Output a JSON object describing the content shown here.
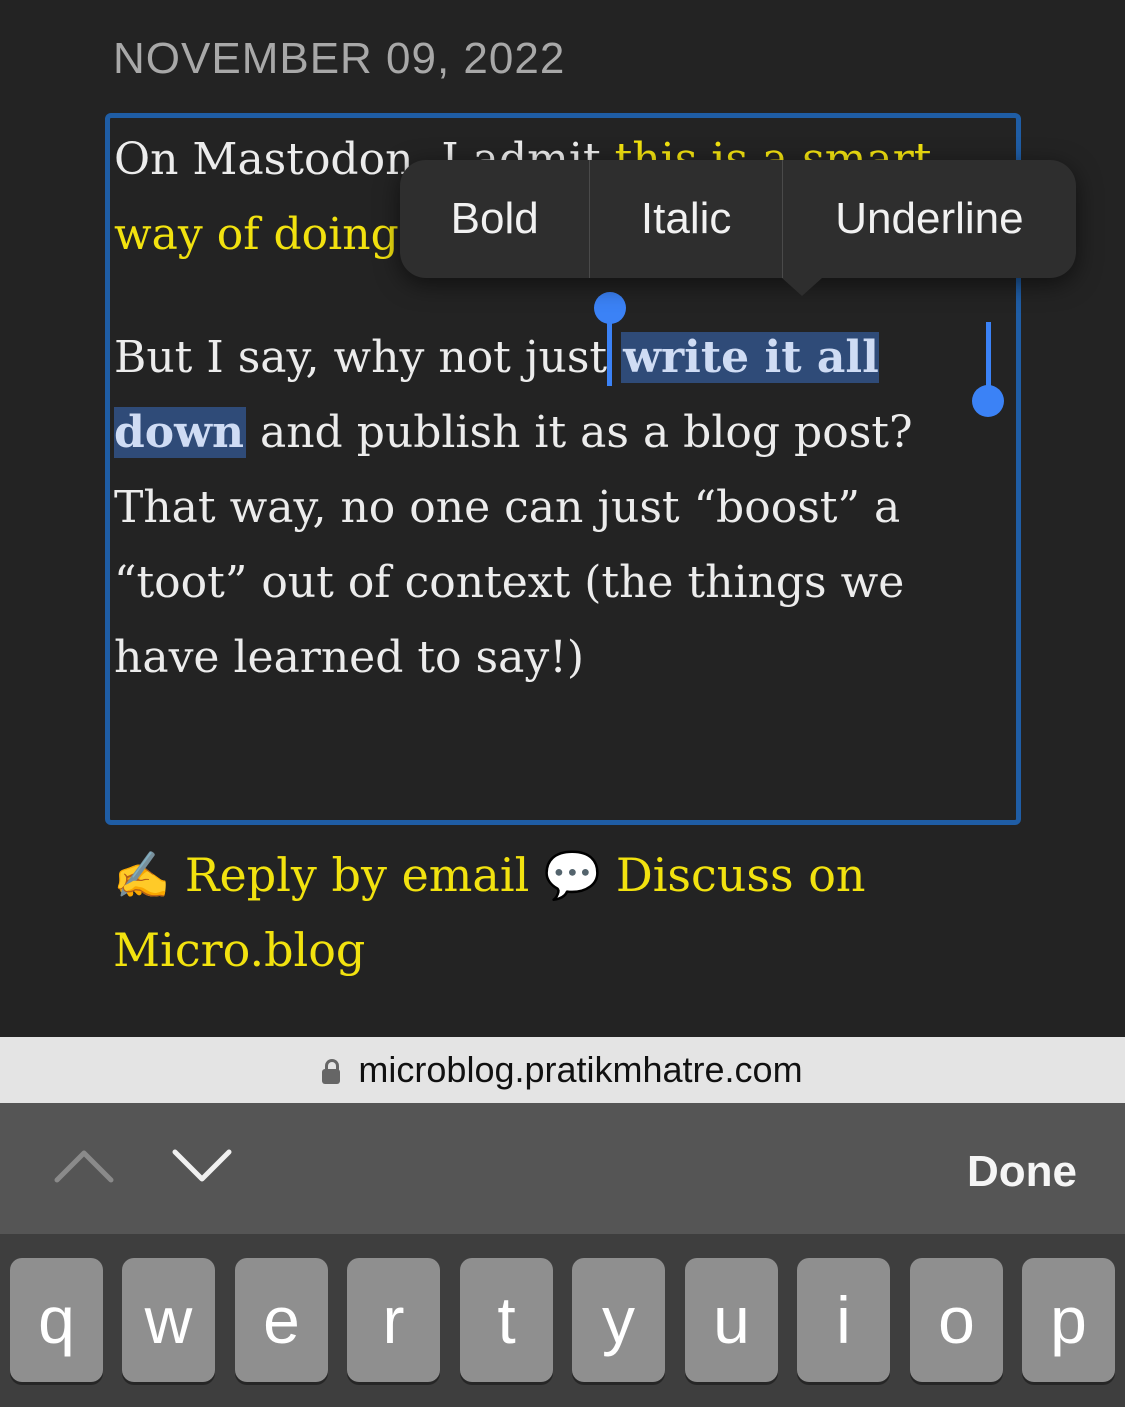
{
  "post": {
    "date": "NOVEMBER 09, 2022",
    "p1_start": "On Mastodon, I admit ",
    "p1_link": "this is a smart way of doing things.",
    "p2_before": "But I say, why not just ",
    "p2_selected": "write it all down",
    "p2_after": " and publish it as a blog post? That way, no one can just “boost” a “toot” out of context (the things we have learned to say!)"
  },
  "format_menu": {
    "bold": "Bold",
    "italic": "Italic",
    "underline": "Underline"
  },
  "footer": {
    "reply_emoji": "✍️",
    "reply": "Reply by email",
    "discuss_emoji": "💬",
    "discuss": "Discuss on Micro.blog"
  },
  "browser": {
    "url": "microblog.pratikmhatre.com"
  },
  "toolbar": {
    "prev_icon": "chevron-up-icon",
    "next_icon": "chevron-down-icon",
    "done": "Done"
  },
  "keyboard": {
    "keys": [
      "q",
      "w",
      "e",
      "r",
      "t",
      "y",
      "u",
      "i",
      "o",
      "p"
    ]
  },
  "colors": {
    "background": "#232323",
    "link": "#f2e20f",
    "focus_border": "#1f5da5",
    "selection": "#3b82f6"
  }
}
